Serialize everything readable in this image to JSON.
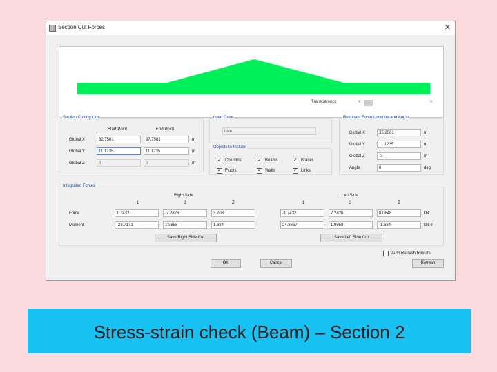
{
  "window": {
    "title": "Section Cut Forces",
    "close_glyph": "✕"
  },
  "transparency": {
    "label": "Transparency",
    "left_arrow": "<",
    "right_arrow": ">"
  },
  "section_cutting_line": {
    "title": "Section Cutting Line",
    "start_header": "Start Point",
    "end_header": "End Point",
    "rows": [
      {
        "label": "Global  X",
        "start": "32.7581",
        "end": "37.7581",
        "unit": "m"
      },
      {
        "label": "Global  Y",
        "start": "11.1235",
        "end": "11.1235",
        "unit": "m"
      },
      {
        "label": "Global  Z",
        "start": "3",
        "end": "3",
        "unit": "m"
      }
    ]
  },
  "load_case": {
    "title": "Load Case",
    "value": "Live"
  },
  "objects_to_include": {
    "title": "Objects to Include",
    "items": [
      {
        "label": "Columns",
        "checked": "✓"
      },
      {
        "label": "Beams",
        "checked": "✓"
      },
      {
        "label": "Braces",
        "checked": "✓"
      },
      {
        "label": "Floors",
        "checked": "✓"
      },
      {
        "label": "Walls",
        "checked": "✓"
      },
      {
        "label": "Links",
        "checked": "✓"
      }
    ]
  },
  "resultant": {
    "title": "Resultant Force Location and Angle",
    "rows": [
      {
        "label": "Global  X",
        "value": "35.2581",
        "unit": "m"
      },
      {
        "label": "Global  Y",
        "value": "11.1235",
        "unit": "m"
      },
      {
        "label": "Global  Z",
        "value": "-3",
        "unit": "m"
      },
      {
        "label": "Angle",
        "value": "0",
        "unit": "deg"
      }
    ]
  },
  "integrated_forces": {
    "title": "Integrated Forces",
    "right_side_label": "Right Side",
    "left_side_label": "Left Side",
    "col_headers": [
      "1",
      "2",
      "Z"
    ],
    "force_label": "Force",
    "moment_label": "Moment",
    "right_force": [
      "1.7432",
      "-7.2826",
      "3.708"
    ],
    "right_moment": [
      "-23.7171",
      "1.3858",
      "1.684"
    ],
    "left_force": [
      "-1.7432",
      "7.2826",
      "8.0646"
    ],
    "left_moment": [
      "24.8667",
      "1.9958",
      "-1.684"
    ],
    "force_unit": "kN",
    "moment_unit": "kN-m",
    "save_right": "Save Right Side Cut",
    "save_left": "Save Left Side Cut"
  },
  "auto_refresh": {
    "label": "Auto Refresh Results",
    "checked": ""
  },
  "buttons": {
    "ok": "OK",
    "cancel": "Cancel",
    "refresh": "Refresh"
  },
  "caption": "Stress-strain check (Beam) – Section 2",
  "colors": {
    "diagram_fill": "#00f05a",
    "caption_bg": "#17c1f1",
    "group_title": "#1a4fa3"
  }
}
